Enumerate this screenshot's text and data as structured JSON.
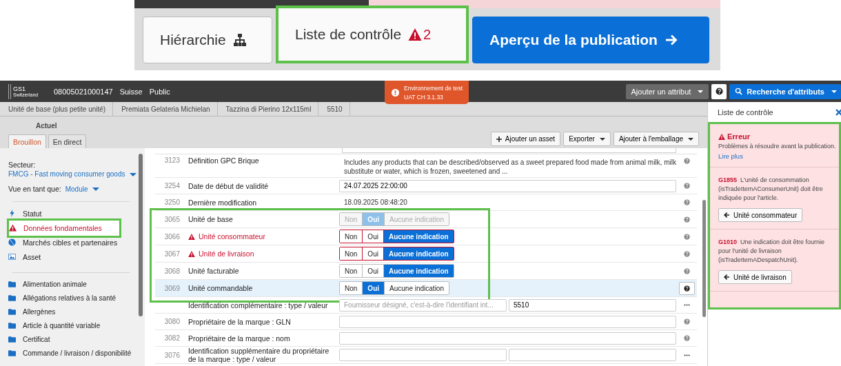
{
  "publish_toolbar": {
    "buttons": [
      {
        "kind": "hierarchy",
        "label": "Hiérarchie",
        "annotated": false
      },
      {
        "kind": "checklist",
        "label": "Liste de contrôle",
        "count": "2",
        "annotated": true
      },
      {
        "kind": "publish",
        "label": "Aperçu de la publication",
        "annotated": false
      }
    ]
  },
  "header": {
    "logo": {
      "text": "GS1",
      "subtitle": "Switzerland"
    },
    "gtin": "08005021000147",
    "country": "Suisse",
    "visibility": "Public",
    "buttons": [
      {
        "kind": "add",
        "label": "Ajouter un attribut"
      },
      {
        "kind": "help"
      },
      {
        "kind": "search",
        "label": "Recherche d'attributs"
      }
    ]
  },
  "toast": {
    "title": "Environnement de test",
    "subtitle": "UAT CH 3.1.33"
  },
  "breadcrumb": [
    "Unité de base (plus petite unité)",
    "Premiata Gelateria Michielan",
    "Tazzina di Pierino 12x115ml",
    "5510"
  ],
  "version": {
    "label": "Actuel",
    "tabs": [
      {
        "label": "Brouillon",
        "selected": true
      },
      {
        "label": "En direct",
        "selected": false
      }
    ]
  },
  "actions": [
    {
      "kind": "add",
      "label": "Ajouter un asset"
    },
    {
      "kind": "menu",
      "label": "Exporter"
    },
    {
      "kind": "menu",
      "label": "Ajouter à l'emballage"
    }
  ],
  "sidebar": {
    "sector_label": "Secteur:",
    "sector": "FMCG - Fast moving consumer goods",
    "view_label": "Vue en tant que:",
    "view": "Module",
    "modules": [
      {
        "kind": "status",
        "label": "Statut",
        "error": false,
        "annotated": false
      },
      {
        "kind": "warning",
        "label": "Données fondamentales",
        "error": true,
        "annotated": true
      },
      {
        "kind": "globe",
        "label": "Marchés cibles et partenaires",
        "error": false,
        "annotated": false
      },
      {
        "kind": "image",
        "label": "Asset",
        "error": false,
        "annotated": false
      }
    ],
    "folders": [
      "Alimentation animale",
      "Allégations relatives à la santé",
      "Allergènes",
      "Article à quantité variable",
      "Certificat",
      "Commande / livraison / disponibilité"
    ]
  },
  "table": {
    "groups": [
      {
        "annotated": false,
        "rows": [
          {
            "kind": "text",
            "number": "3123",
            "label": "Définition GPC Brique",
            "error": false,
            "highlighted": false,
            "value": "Includes any products that can be described/observed as a sweet prepared food made from animal milk, milk substitute or water, which is frozen, sweetened and ...",
            "action": {
              "kind": "help"
            }
          },
          {
            "kind": "input",
            "number": "3254",
            "label": "Date de début de validité",
            "error": false,
            "highlighted": false,
            "value": "24.07.2025 22:00:00",
            "action": {
              "kind": "help"
            }
          },
          {
            "kind": "text",
            "number": "3250",
            "label": "Dernière modification",
            "error": false,
            "highlighted": false,
            "value": "18.09.2025 08:48:20",
            "action": {
              "kind": "help"
            }
          }
        ]
      },
      {
        "annotated": true,
        "rows": [
          {
            "kind": "toggle",
            "number": "3065",
            "label": "Unité de base",
            "error": false,
            "disabled": true,
            "highlighted": false,
            "options": [
              {
                "label": "Non",
                "selected": false
              },
              {
                "label": "Oui",
                "selected": true
              },
              {
                "label": "Aucune indication",
                "selected": false
              }
            ],
            "action": {
              "kind": "help"
            }
          },
          {
            "kind": "toggle",
            "number": "3066",
            "label": "Unité consommateur",
            "error": true,
            "disabled": false,
            "highlighted": false,
            "options": [
              {
                "label": "Non",
                "selected": false
              },
              {
                "label": "Oui",
                "selected": false
              },
              {
                "label": "Aucune indication",
                "selected": true
              }
            ],
            "action": {
              "kind": "help"
            }
          },
          {
            "kind": "toggle",
            "number": "3067",
            "label": "Unité de livraison",
            "error": true,
            "disabled": false,
            "highlighted": false,
            "options": [
              {
                "label": "Non",
                "selected": false
              },
              {
                "label": "Oui",
                "selected": false
              },
              {
                "label": "Aucune indication",
                "selected": true
              }
            ],
            "action": {
              "kind": "help"
            }
          },
          {
            "kind": "toggle",
            "number": "3068",
            "label": "Unité facturable",
            "error": false,
            "disabled": false,
            "highlighted": false,
            "options": [
              {
                "label": "Non",
                "selected": false
              },
              {
                "label": "Oui",
                "selected": false
              },
              {
                "label": "Aucune indication",
                "selected": true
              }
            ],
            "action": {
              "kind": "help"
            }
          },
          {
            "kind": "toggle",
            "number": "3069",
            "label": "Unité commandable",
            "error": false,
            "disabled": false,
            "highlighted": true,
            "options": [
              {
                "label": "Non",
                "selected": false
              },
              {
                "label": "Oui",
                "selected": true
              },
              {
                "label": "Aucune indication",
                "selected": false
              }
            ],
            "action": {
              "kind": "help"
            }
          }
        ]
      },
      {
        "annotated": false,
        "rows": [
          {
            "kind": "pair",
            "label": "Identification complémentaire : type / valeur",
            "error": false,
            "highlighted": false,
            "placeholder": "Fournisseur désigné, c'est-à-dire l'identifiant int...",
            "value": "5510",
            "action": {
              "kind": "more"
            }
          },
          {
            "kind": "input",
            "number": "3080",
            "label": "Propriétaire de la marque : GLN",
            "error": false,
            "highlighted": false,
            "action": {
              "kind": "help"
            }
          },
          {
            "kind": "input",
            "number": "3082",
            "label": "Propriétaire de la marque : nom",
            "error": false,
            "highlighted": false,
            "action": {
              "kind": "help"
            }
          },
          {
            "kind": "pair",
            "number": "3076",
            "label": "Identification supplémentaire du propriétaire de la marque : type / valeur",
            "error": false,
            "highlighted": false,
            "action": {
              "kind": "more"
            }
          }
        ]
      }
    ]
  },
  "checklist": {
    "title": "Liste de contrôle",
    "annotated": true,
    "error": {
      "title": "Erreur",
      "text": "Problèmes à résoudre avant la publication.",
      "link": "Lire plus"
    },
    "issues": [
      {
        "code": "G1855",
        "text": "L'unité de consommation (isTradeItemAConsumerUnit) doit être indiquée pour l'article.",
        "button": "Unité consommateur"
      },
      {
        "code": "G1010",
        "text": "Une indication doit être fournie pour l'unité de livraison (isTradeItemADespatchUnit).",
        "button": "Unité de livraison"
      }
    ]
  }
}
